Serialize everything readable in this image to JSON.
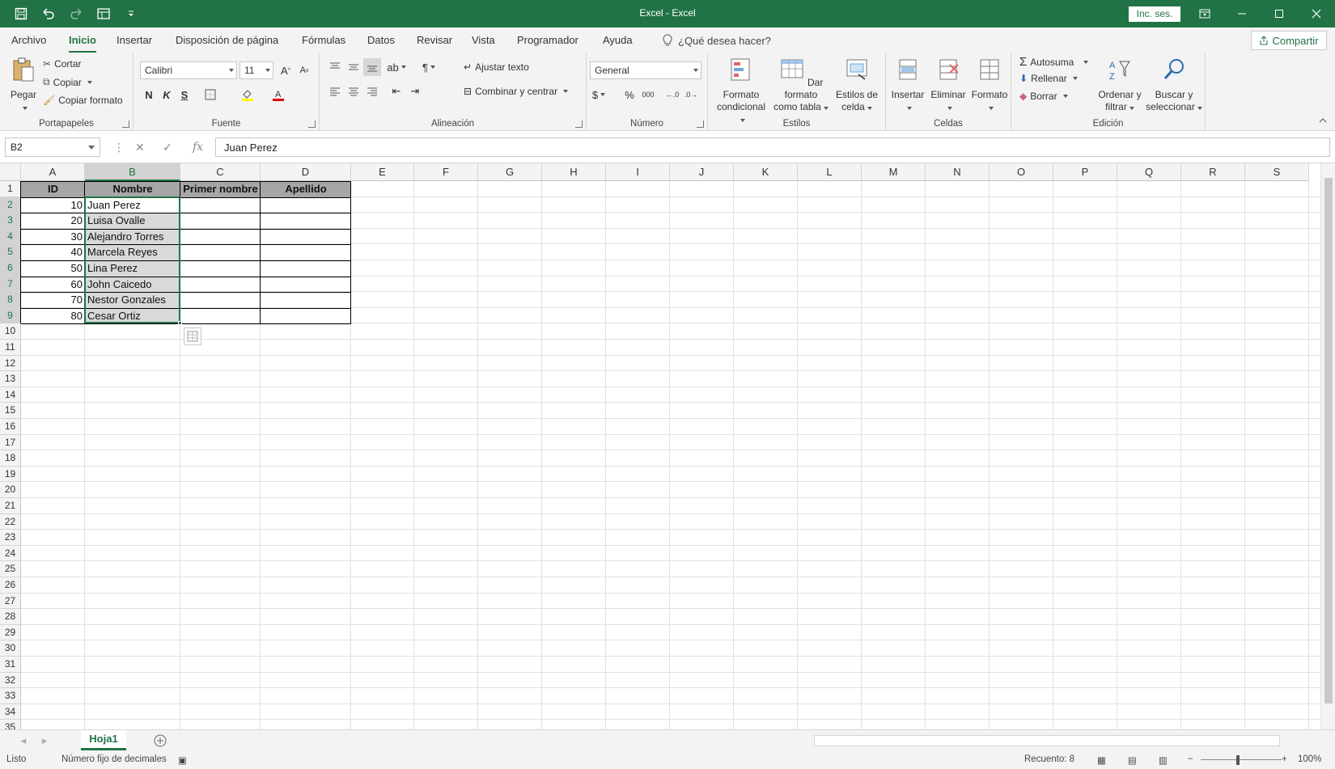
{
  "titlebar": {
    "title": "Excel  -  Excel",
    "signin": "Inc. ses."
  },
  "tabs": [
    "Archivo",
    "Inicio",
    "Insertar",
    "Disposición de página",
    "Fórmulas",
    "Datos",
    "Revisar",
    "Vista",
    "Programador",
    "Ayuda"
  ],
  "tell_me": "¿Qué desea hacer?",
  "share": "Compartir",
  "ribbon": {
    "clipboard": {
      "label": "Portapapeles",
      "paste": "Pegar",
      "cut": "Cortar",
      "copy": "Copiar",
      "format_painter": "Copiar formato"
    },
    "font": {
      "label": "Fuente",
      "name": "Calibri",
      "size": "11",
      "bold": "N",
      "italic": "K",
      "underline": "S"
    },
    "alignment": {
      "label": "Alineación",
      "wrap": "Ajustar texto",
      "merge": "Combinar y centrar"
    },
    "number": {
      "label": "Número",
      "format": "General",
      "currency": "$",
      "percent": "%",
      "thousands": "000"
    },
    "styles": {
      "label": "Estilos",
      "conditional": [
        "Formato",
        "condicional"
      ],
      "table": [
        "Dar formato",
        "como tabla"
      ],
      "cell": [
        "Estilos de",
        "celda"
      ]
    },
    "cells": {
      "label": "Celdas",
      "insert": "Insertar",
      "delete": "Eliminar",
      "format": "Formato"
    },
    "editing": {
      "label": "Edición",
      "autosum": "Autosuma",
      "fill": "Rellenar",
      "clear": "Borrar",
      "sort": [
        "Ordenar y",
        "filtrar"
      ],
      "find": [
        "Buscar y",
        "seleccionar"
      ]
    }
  },
  "formula_bar": {
    "name_box": "B2",
    "fx": "fx",
    "value": "Juan Perez"
  },
  "columns": [
    "A",
    "B",
    "C",
    "D",
    "E",
    "F",
    "G",
    "H",
    "I",
    "J",
    "K",
    "L",
    "M",
    "N",
    "O",
    "P",
    "Q",
    "R",
    "S"
  ],
  "rows": [
    "1",
    "2",
    "3",
    "4",
    "5",
    "6",
    "7",
    "8",
    "9",
    "10",
    "11",
    "12",
    "13",
    "14",
    "15",
    "16",
    "17",
    "18",
    "19",
    "20",
    "21",
    "22",
    "23",
    "24",
    "25",
    "26",
    "27",
    "28",
    "29",
    "30",
    "31",
    "32",
    "33",
    "34",
    "35"
  ],
  "table": {
    "headers": [
      "ID",
      "Nombre",
      "Primer nombre",
      "Apellido"
    ],
    "rows": [
      [
        "10",
        "Juan Perez",
        "",
        ""
      ],
      [
        "20",
        "Luisa Ovalle",
        "",
        ""
      ],
      [
        "30",
        "Alejandro Torres",
        "",
        ""
      ],
      [
        "40",
        "Marcela Reyes",
        "",
        ""
      ],
      [
        "50",
        "Lina Perez",
        "",
        ""
      ],
      [
        "60",
        "John Caicedo",
        "",
        ""
      ],
      [
        "70",
        "Nestor Gonzales",
        "",
        ""
      ],
      [
        "80",
        "Cesar Ortiz",
        "",
        ""
      ]
    ]
  },
  "sheet_tab": "Hoja1",
  "status": {
    "ready": "Listo",
    "fixed_decimals": "Número fijo de decimales",
    "count": "Recuento: 8",
    "zoom": "100%"
  },
  "colors": {
    "accent": "#217346",
    "header_fill": "#a6a6a6",
    "selection_fill": "#d9d9d9"
  }
}
